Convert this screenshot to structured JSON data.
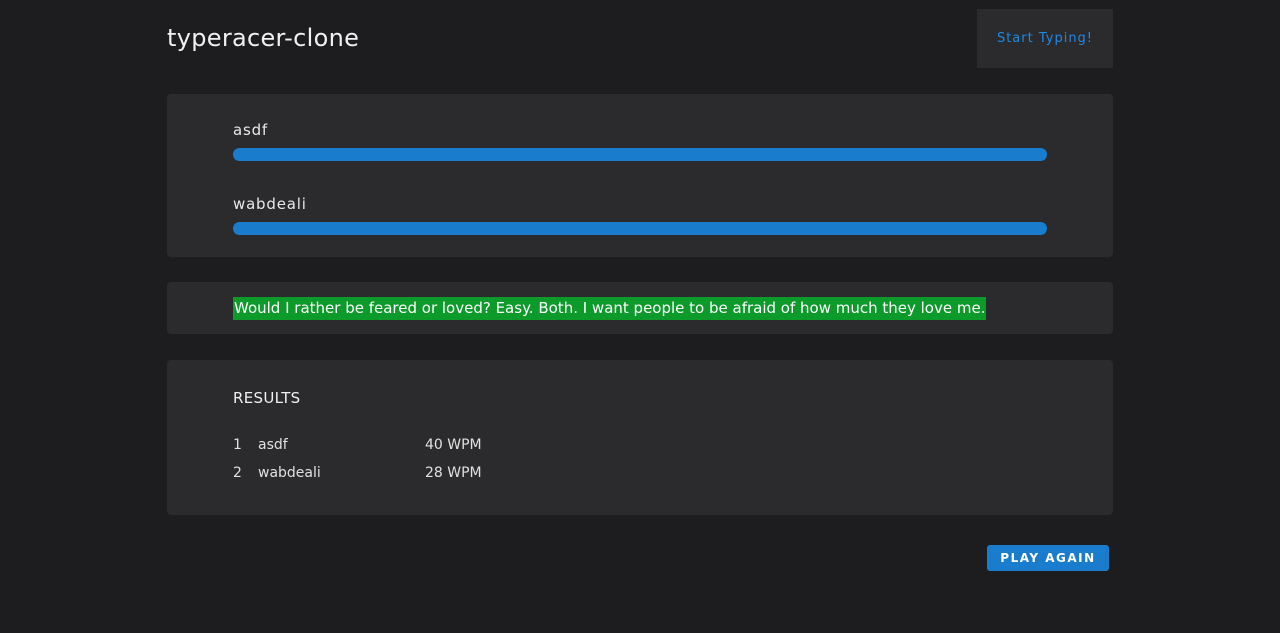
{
  "header": {
    "app_title": "typeracer-clone",
    "start_label": "Start Typing!"
  },
  "players": [
    {
      "name": "asdf",
      "progress": 1.0
    },
    {
      "name": "wabdeali",
      "progress": 1.0
    }
  ],
  "quote": {
    "text": "Would I rather be feared or loved? Easy. Both. I want people to be afraid of how much they love me."
  },
  "results": {
    "title": "RESULTS",
    "rows": [
      {
        "rank": "1",
        "name": "asdf",
        "wpm": "40 WPM"
      },
      {
        "rank": "2",
        "name": "wabdeali",
        "wpm": "28 WPM"
      }
    ]
  },
  "actions": {
    "play_again_label": "PLAY AGAIN"
  },
  "colors": {
    "background": "#1d1d1f",
    "card": "#2b2b2d",
    "accent": "#1a7ccc",
    "quote_highlight": "#0c9a2a"
  }
}
